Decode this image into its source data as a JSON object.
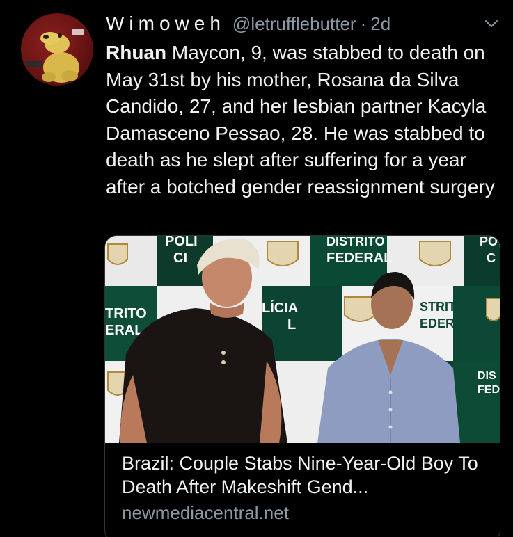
{
  "tweet": {
    "display_name": "Wimoweh",
    "handle": "@letrufflebutter",
    "separator": "·",
    "time": "2d",
    "text_first_word": "Rhuan",
    "text_rest": " Maycon, 9, was stabbed to death on May 31st by his mother, Rosana da Silva Candido, 27, and her lesbian partner Kacyla Damasceno Pessao, 28. He was stabbed to death as he slept after suffering for a year after a botched gender reassignment surgery"
  },
  "card": {
    "title": "Brazil: Couple Stabs Nine-Year-Old Boy To Death After Makeshift Gend...",
    "domain": "newmediacentral.net",
    "backdrop_text": {
      "poli": "POLI",
      "ci": "CI",
      "distrito": "DISTRITO",
      "federal": "FEDERAL",
      "po": "PO",
      "c": "C",
      "trito": "TRITO",
      "eral": "ERAL",
      "licia": "LÍCIA",
      "l": "L",
      "strito": "STRITO",
      "ederal": "EDERAL",
      "dis": "DIS",
      "fed": "FED"
    }
  },
  "icons": {
    "avatar": "puppet-avatar",
    "menu": "chevron-down-icon"
  },
  "colors": {
    "background": "#000000",
    "text": "#f1f1f1",
    "secondary": "#8b98a5",
    "border": "#2f3336",
    "accent": "#1da1f2"
  }
}
